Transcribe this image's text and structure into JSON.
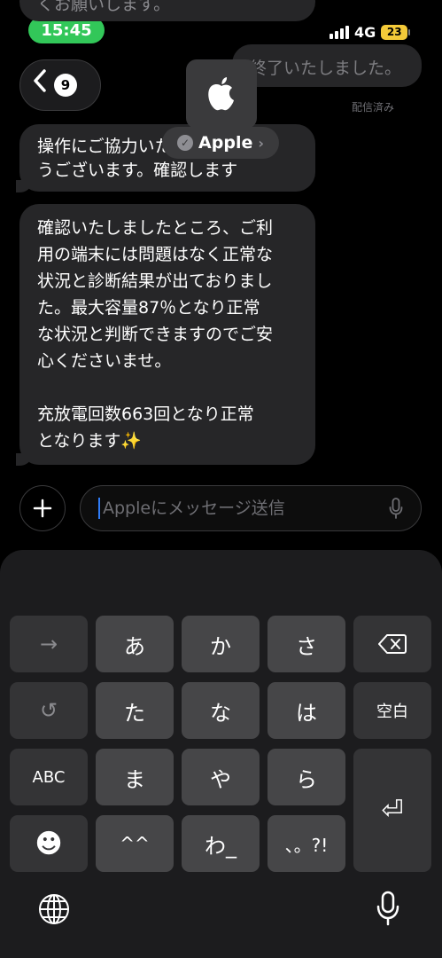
{
  "status_bar": {
    "time": "15:45",
    "network": "4G",
    "battery": "23"
  },
  "header": {
    "unread_count": "9",
    "contact_name": "Apple"
  },
  "messages": {
    "partial_top": "くお願いします。",
    "outgoing": "終了いたしました。",
    "delivered": "配信済み",
    "incoming_1": [
      "操作にご協力いただきありがと",
      "うございます。確認します"
    ],
    "incoming_2": [
      "確認いたしましたところ、ご利",
      "用の端末には問題はなく正常な",
      "状況と診断結果が出ておりまし",
      "た。最大容量87％となり正常",
      "な状況と判断できますのでご安",
      "心くださいませ。",
      "",
      "充放電回数663回となり正常",
      "となります✨"
    ]
  },
  "input": {
    "placeholder": "Appleにメッセージ送信"
  },
  "keyboard": {
    "row1": [
      "→",
      "あ",
      "か",
      "さ"
    ],
    "row2": [
      "↺",
      "た",
      "な",
      "は",
      "空白"
    ],
    "row3": [
      "ABC",
      "ま",
      "や",
      "ら"
    ],
    "row4": [
      "☻",
      "^^",
      "わ_",
      "、。?!"
    ],
    "return": "⏎"
  },
  "colors": {
    "accent_green": "#32c759",
    "battery_yellow": "#f4ca39",
    "caret_blue": "#2f7cf6"
  }
}
